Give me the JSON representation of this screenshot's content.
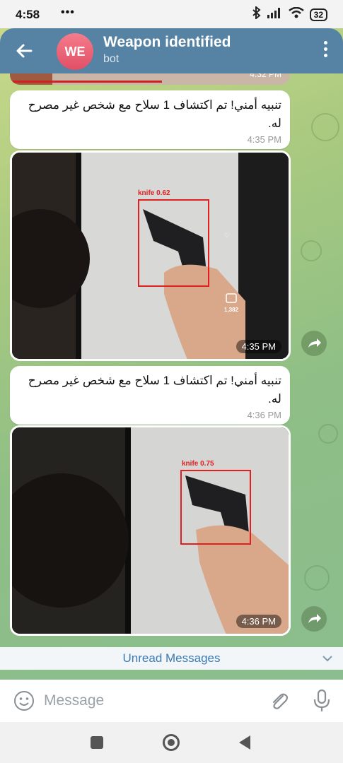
{
  "status_bar": {
    "time": "4:58",
    "dots": "•••",
    "battery": "32"
  },
  "header": {
    "avatar_initials": "WE",
    "title": "Weapon identified",
    "subtitle": "bot",
    "back_icon": "arrow-left-icon",
    "more_icon": "vertical-dots-icon"
  },
  "messages": [
    {
      "type": "text",
      "text": "تنبيه أمني! تم اكتشاف 1 سلاح مع شخص غير مصرح له.",
      "time": "4:35 PM"
    },
    {
      "type": "photo",
      "time": "4:35 PM",
      "detection_label": "knife 0.62",
      "overlay_count": "1,382"
    },
    {
      "type": "text",
      "text": "تنبيه أمني! تم اكتشاف 1 سلاح مع شخص غير مصرح له.",
      "time": "4:36 PM"
    },
    {
      "type": "photo",
      "time": "4:36 PM",
      "detection_label": "knife 0.75"
    }
  ],
  "top_partial_time": "4:32 PM",
  "unread_label": "Unread Messages",
  "input": {
    "placeholder": "Message"
  },
  "colors": {
    "header": "#5682a3",
    "accent": "#3c7ab2",
    "detection": "#e02020",
    "avatar": "#e14f65"
  }
}
